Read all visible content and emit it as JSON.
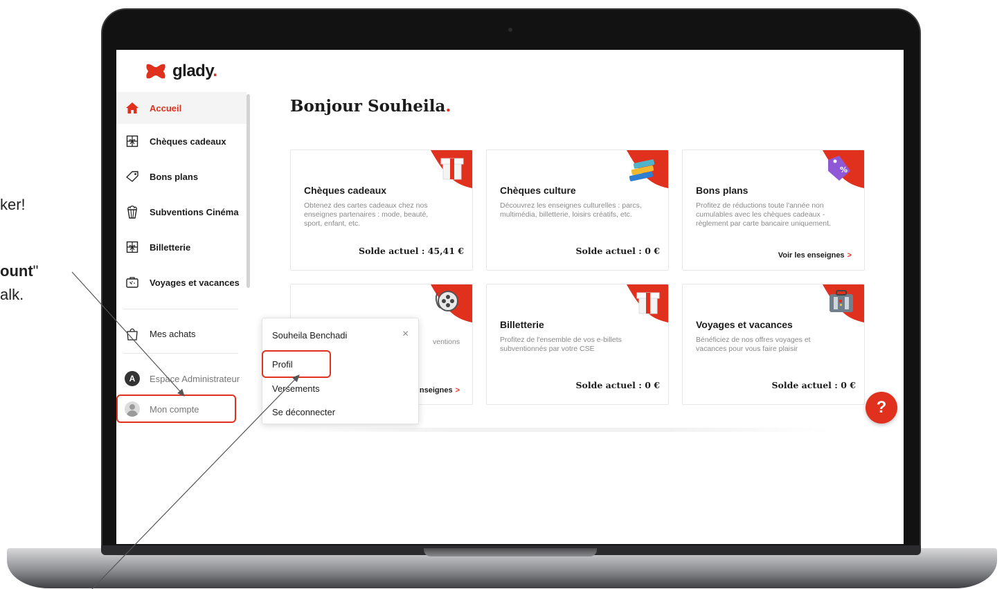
{
  "instruction": {
    "line1": "ker!",
    "line2_bold": "ount",
    "line2_rest": "\"",
    "line3": "alk."
  },
  "sidebar": {
    "logo": "glady",
    "logo_dot": ".",
    "items": [
      {
        "label": "Accueil",
        "icon": "home-icon",
        "active": true
      },
      {
        "label": "Chèques cadeaux",
        "icon": "gift-box-icon"
      },
      {
        "label": "Bons plans",
        "icon": "tag-icon"
      },
      {
        "label": "Subventions Cinéma",
        "icon": "popcorn-icon"
      },
      {
        "label": "Billetterie",
        "icon": "ticket-icon"
      },
      {
        "label": "Voyages et vacances",
        "icon": "suitcase-icon"
      },
      {
        "label": "Mes achats",
        "icon": "shopping-bag-icon"
      }
    ],
    "admin": {
      "avatar": "A",
      "label": "Espace Administrateur"
    },
    "account": {
      "label": "Mon compte"
    }
  },
  "main": {
    "greeting": "Bonjour Souheila",
    "greeting_dot": ".",
    "cards": [
      {
        "title": "Chèques cadeaux",
        "desc": "Obtenez des cartes cadeaux chez nos enseignes partenaires : mode, beauté, sport, enfant, etc.",
        "balance": "Solde actuel : 45,41 €",
        "icon": "gift-icon"
      },
      {
        "title": "Chèques culture",
        "desc": "Découvrez les enseignes culturelles : parcs, multimédia, billetterie, loisirs créatifs, etc.",
        "balance": "Solde actuel : 0 €",
        "icon": "books-icon"
      },
      {
        "title": "Bons plans",
        "desc": "Profitez de réductions toute l'année non cumulables avec les chèques cadeaux - règlement par carte bancaire uniquement.",
        "link": "Voir les enseignes",
        "icon": "discount-tag-icon"
      },
      {
        "title": "",
        "desc": "ventions",
        "link": "nseignes",
        "icon": "film-reel-icon"
      },
      {
        "title": "Billetterie",
        "desc": "Profitez de l'ensemble de vos e-billets subventionnés par votre CSE",
        "balance": "Solde actuel : 0 €",
        "icon": "gift-icon"
      },
      {
        "title": "Voyages et vacances",
        "desc": "Bénéficiez de nos offres voyages et vacances pour vous faire plaisir",
        "balance": "Solde actuel : 0 €",
        "icon": "suitcase-icon"
      }
    ],
    "help": "?"
  },
  "account_menu": {
    "name": "Souheila Benchadi",
    "close": "×",
    "items": [
      "Profil",
      "Versements",
      "Se déconnecter"
    ]
  },
  "colors": {
    "accent": "#e0301e",
    "text": "#1c1c1c",
    "muted": "#8a8a8a"
  }
}
